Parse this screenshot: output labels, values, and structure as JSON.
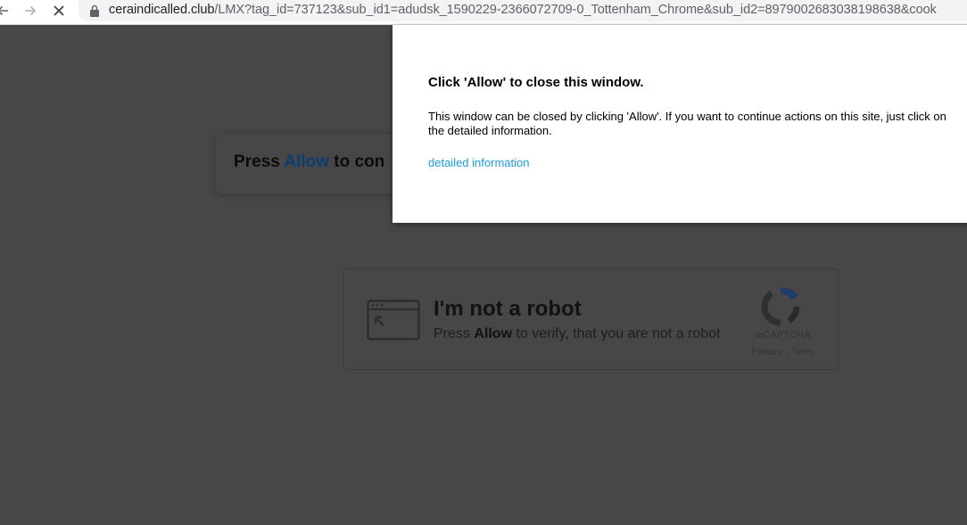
{
  "browser": {
    "url_host": "ceraindicalled.club",
    "url_path": "/LMX?tag_id=737123&sub_id1=adudsk_1590229-2366072709-0_Tottenham_Chrome&sub_id2=8979002683038198638&cook"
  },
  "page": {
    "press_prefix": "Press ",
    "press_allow": "Allow",
    "press_suffix": " to con",
    "captcha": {
      "title": "I'm not a robot",
      "sub_prefix": "Press ",
      "sub_allow": "Allow",
      "sub_suffix": " to verify, that you are not a robot",
      "recaptcha_label": "reCAPTCHA",
      "recaptcha_links": "Privacy - Term"
    }
  },
  "popup": {
    "title": "Click 'Allow' to close this window.",
    "body": "This window can be closed by clicking 'Allow'. If you want to continue actions on this site, just click on the detailed information.",
    "link": "detailed information"
  },
  "colors": {
    "overlay": "#474747",
    "link": "#1a9be0",
    "allow_text": "#0b3f73"
  }
}
